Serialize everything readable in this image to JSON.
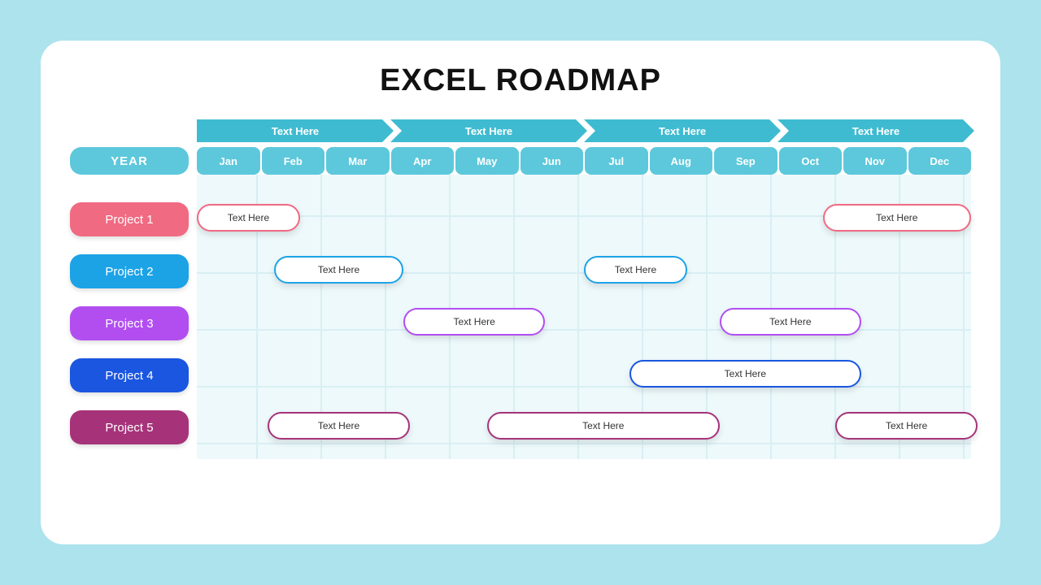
{
  "title": "EXCEL ROADMAP",
  "year_label": "YEAR",
  "quarters": [
    "Text Here",
    "Text Here",
    "Text Here",
    "Text Here"
  ],
  "months": [
    "Jan",
    "Feb",
    "Mar",
    "Apr",
    "May",
    "Jun",
    "Jul",
    "Aug",
    "Sep",
    "Oct",
    "Nov",
    "Dec"
  ],
  "colors": {
    "project1": "#f06a82",
    "project2": "#1ca3e6",
    "project3": "#b24ef0",
    "project4": "#1a56e0",
    "project5": "#a6337a"
  },
  "rows": [
    {
      "name": "Project 1",
      "color_key": "project1",
      "bars": [
        {
          "label": "Text Here",
          "start": 0,
          "span": 1.6
        },
        {
          "label": "Text Here",
          "start": 9.7,
          "span": 2.3
        }
      ]
    },
    {
      "name": "Project 2",
      "color_key": "project2",
      "bars": [
        {
          "label": "Text Here",
          "start": 1.2,
          "span": 2.0
        },
        {
          "label": "Text Here",
          "start": 6.0,
          "span": 1.6
        }
      ]
    },
    {
      "name": "Project 3",
      "color_key": "project3",
      "bars": [
        {
          "label": "Text Here",
          "start": 3.2,
          "span": 2.2
        },
        {
          "label": "Text Here",
          "start": 8.1,
          "span": 2.2
        }
      ]
    },
    {
      "name": "Project 4",
      "color_key": "project4",
      "bars": [
        {
          "label": "Text Here",
          "start": 6.7,
          "span": 3.6
        }
      ]
    },
    {
      "name": "Project 5",
      "color_key": "project5",
      "bars": [
        {
          "label": "Text Here",
          "start": 1.1,
          "span": 2.2
        },
        {
          "label": "Text Here",
          "start": 4.5,
          "span": 3.6
        },
        {
          "label": "Text Here",
          "start": 9.9,
          "span": 2.2
        }
      ]
    }
  ]
}
